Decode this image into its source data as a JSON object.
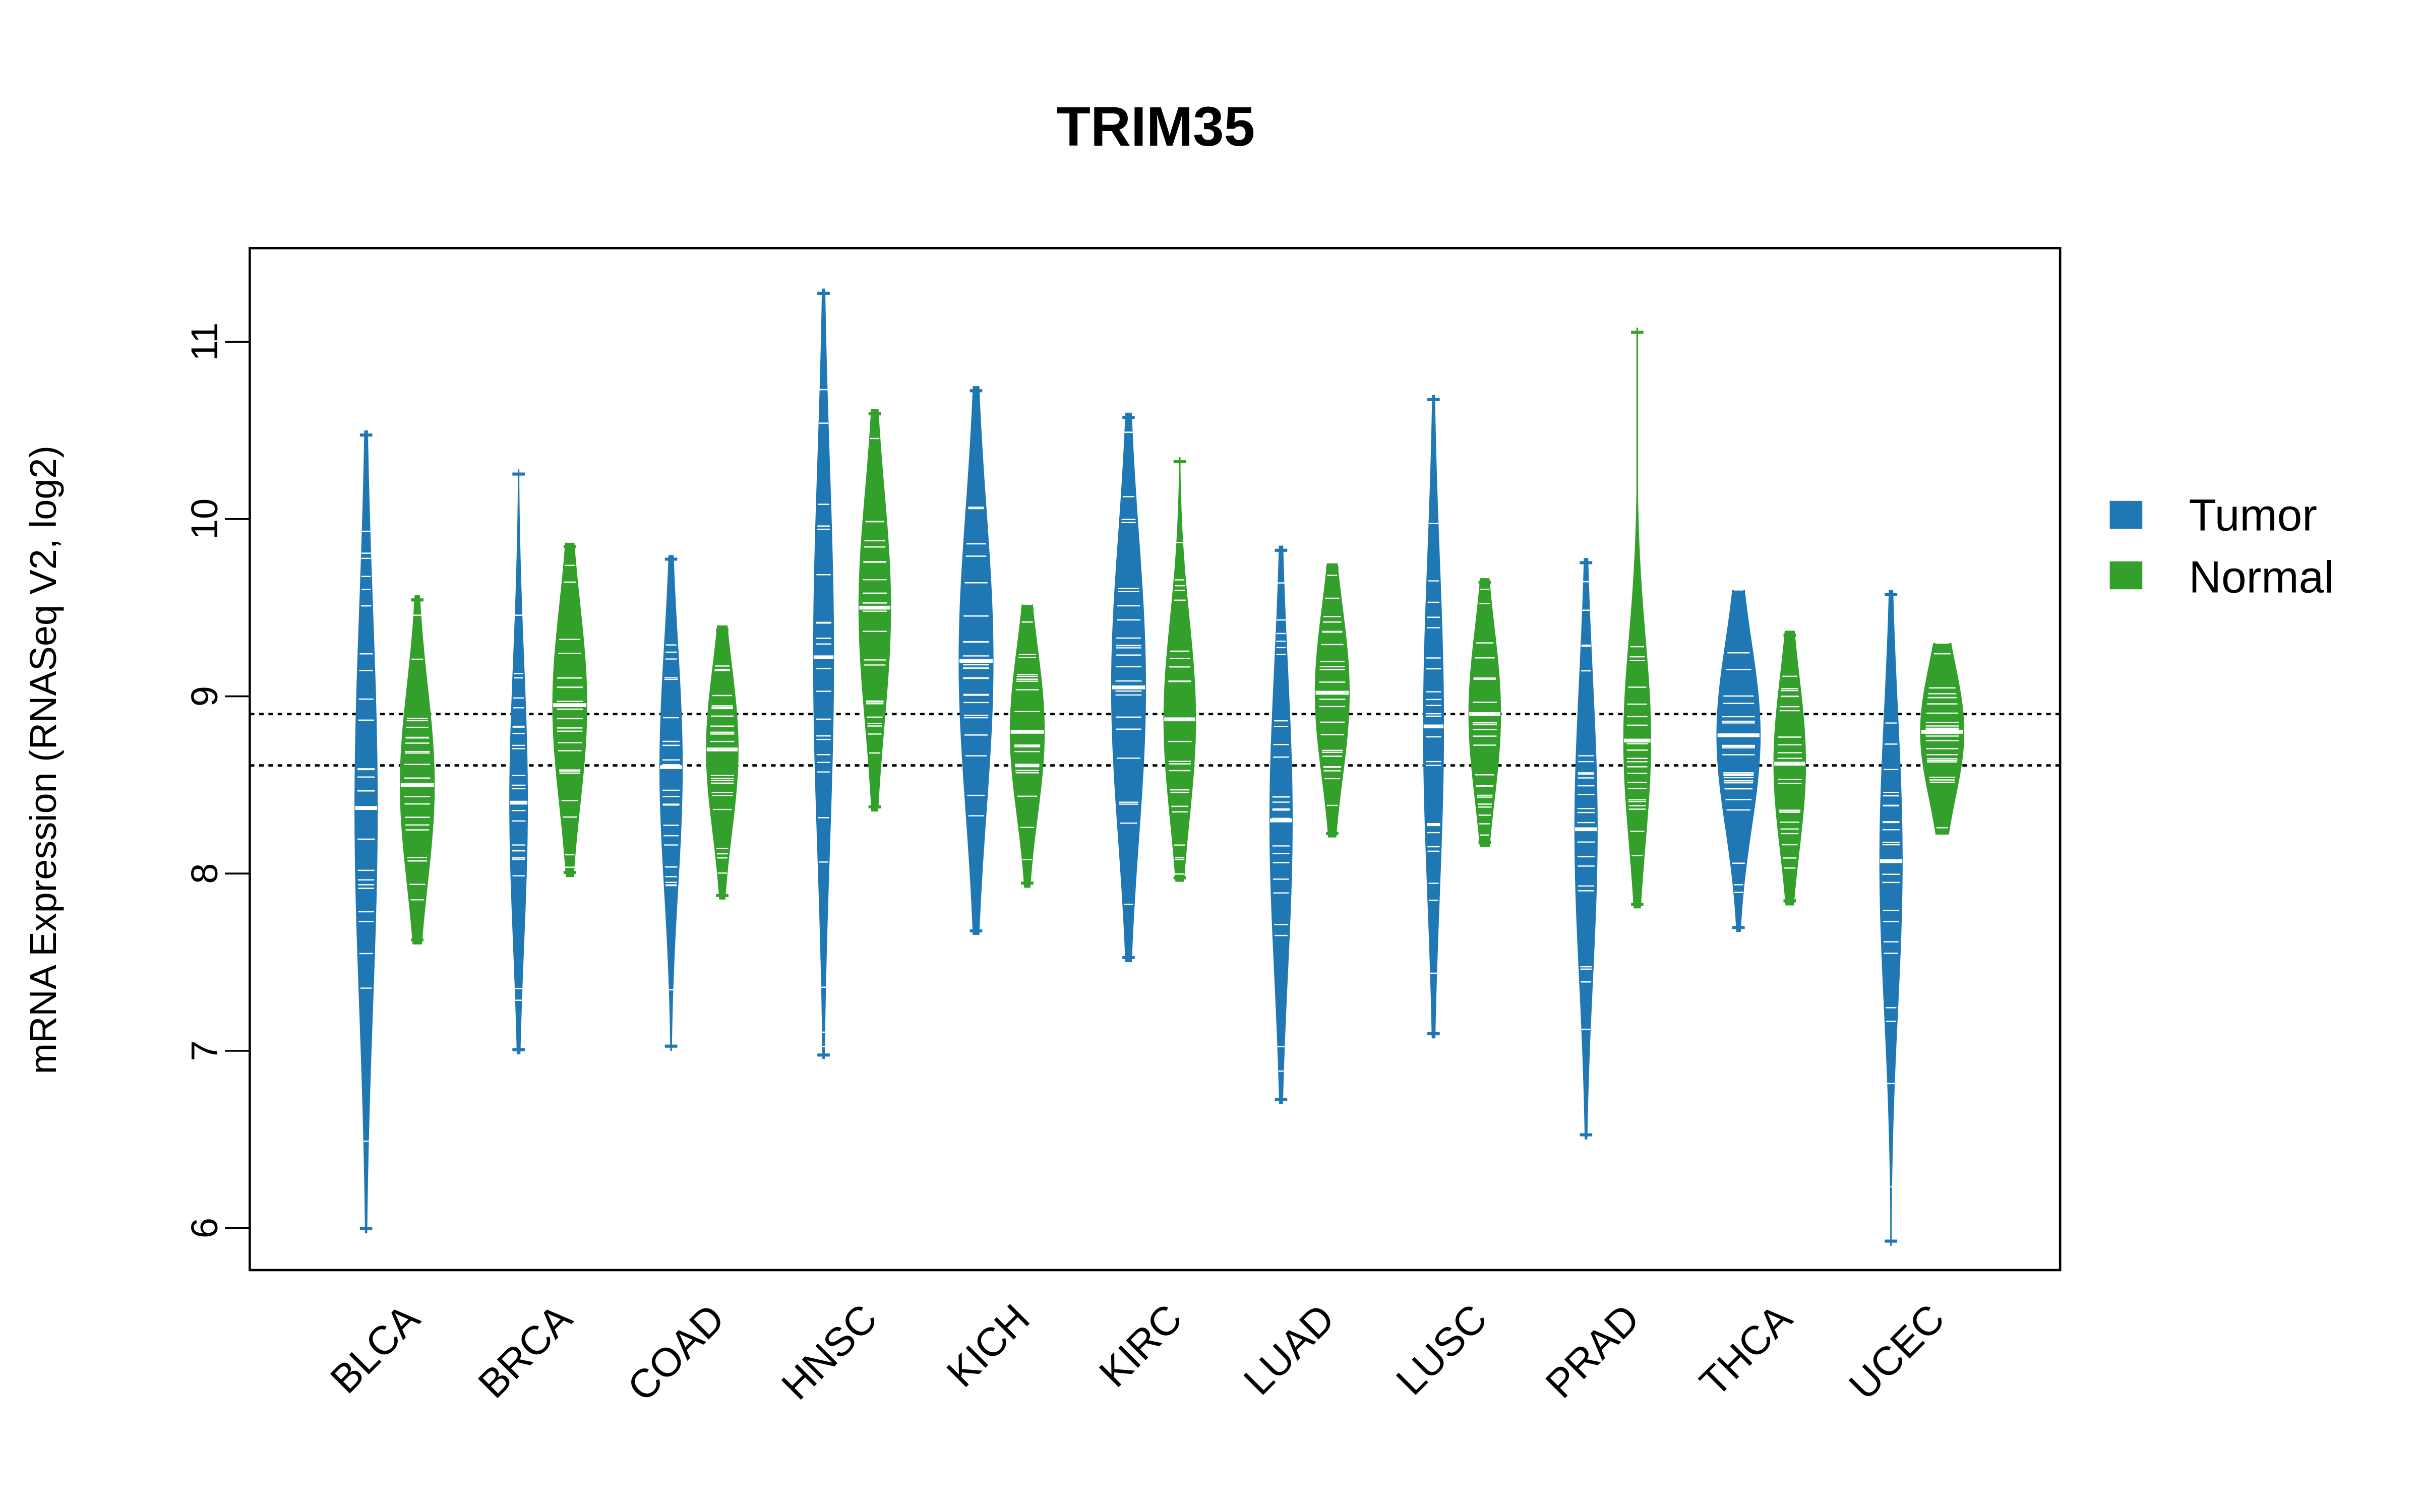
{
  "chart_data": {
    "type": "beanplot",
    "title": "TRIM35",
    "xlabel": "",
    "ylabel": "mRNA Expression (RNASeq V2, log2)",
    "ylim": [
      5.8,
      11.5
    ],
    "yticks": [
      "6",
      "7",
      "8",
      "9",
      "10",
      "11"
    ],
    "reference_lines": [
      8.9,
      8.61
    ],
    "legend": {
      "position": "right",
      "entries": [
        {
          "name": "Tumor",
          "color": "#1f77b4"
        },
        {
          "name": "Normal",
          "color": "#33a02c"
        }
      ]
    },
    "categories": [
      "BLCA",
      "BRCA",
      "COAD",
      "HNSC",
      "KICH",
      "KIRC",
      "LUAD",
      "LUSC",
      "PRAD",
      "THCA",
      "UCEC"
    ],
    "series": [
      {
        "name": "Tumor",
        "color": "#1f77b4",
        "median": [
          8.37,
          8.4,
          8.6,
          9.22,
          9.2,
          9.05,
          8.3,
          8.83,
          8.25,
          8.78,
          8.07
        ],
        "min": [
          5.97,
          6.98,
          7.0,
          6.95,
          7.65,
          7.5,
          6.7,
          7.07,
          6.5,
          7.67,
          5.9
        ],
        "max": [
          10.5,
          10.28,
          9.8,
          11.3,
          10.75,
          10.6,
          9.85,
          10.7,
          9.78,
          9.6,
          9.6
        ],
        "width": [
          0.5,
          0.4,
          0.5,
          0.45,
          0.75,
          0.75,
          0.5,
          0.45,
          0.5,
          0.95,
          0.5
        ]
      },
      {
        "name": "Normal",
        "color": "#33a02c",
        "median": [
          8.5,
          8.95,
          8.7,
          9.5,
          8.8,
          8.87,
          9.02,
          8.9,
          8.75,
          8.62,
          8.8
        ],
        "min": [
          7.6,
          7.98,
          7.85,
          8.35,
          7.92,
          7.95,
          8.2,
          8.15,
          7.8,
          7.82,
          8.22
        ],
        "max": [
          9.57,
          9.87,
          9.4,
          10.62,
          9.52,
          10.35,
          9.75,
          9.67,
          11.08,
          9.37,
          9.3
        ],
        "width": [
          0.75,
          0.75,
          0.7,
          0.7,
          0.75,
          0.7,
          0.75,
          0.7,
          0.6,
          0.7,
          0.95
        ]
      }
    ]
  }
}
